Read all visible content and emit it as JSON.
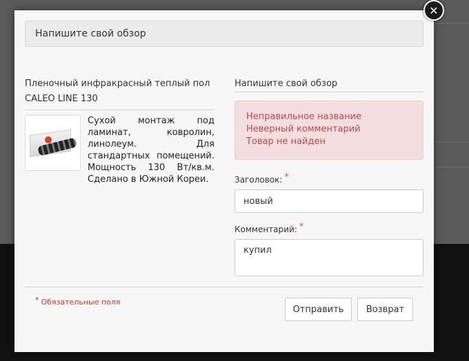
{
  "modal": {
    "header_title": "Напишите свой обзор",
    "close_symbol": "✕"
  },
  "product": {
    "title": "Пленочный инфракрасный теплый пол CALEO LINE 130",
    "description": "Сухой монтаж под ламинат, ковролин, линолеум. Для стандартных помещений. Мощность 130 Вт/кв.м. Сделано в Южной Кореи.",
    "image_icon": "product-thumbnail"
  },
  "review": {
    "title": "Напишите свой обзор",
    "errors": [
      "Неправильное название",
      "Неверный комментарий",
      "Товар не найден"
    ],
    "heading_label": "Заголовок:",
    "heading_value": "новый",
    "comment_label": "Комментарий:",
    "comment_value": "купил",
    "required_star": "*"
  },
  "footer": {
    "required_note": "Обязательные поля",
    "submit_label": "Отправить",
    "back_label": "Возврат"
  },
  "colors": {
    "error_bg": "#f2dede",
    "error_text": "#b94a48",
    "required": "#d9534f"
  }
}
